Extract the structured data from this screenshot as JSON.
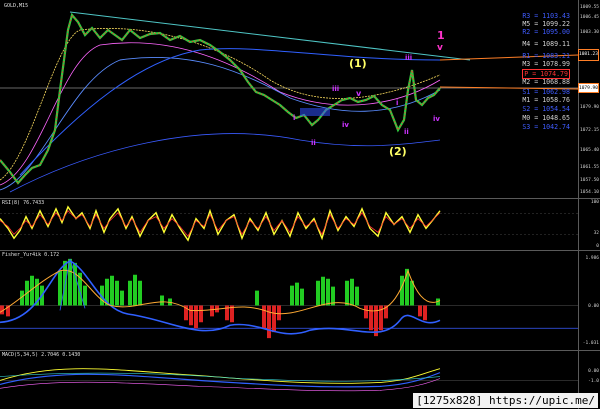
{
  "main_chart": {
    "symbol_label": "GOLD,M15",
    "price_ticks": [
      "1009.55",
      "1006.45",
      "1003.30",
      "1001.19",
      "1079.90",
      "1072.15",
      "1065.40",
      "1061.55",
      "1057.50",
      "1054.10"
    ],
    "current_price": "1079.90",
    "upper_box": "1081.23",
    "wave_labels": {
      "big_1": "1",
      "big_v": "v",
      "paren_1": "(1)",
      "paren_2": "(2)",
      "iii_top": "iii",
      "iii_left": "iii",
      "v_mid": "v",
      "iv_mid": "iv",
      "iv_right": "iv",
      "ii_left": "ii",
      "ii_right": "ii",
      "i_left": "i",
      "i_right": "i"
    },
    "pivot_levels": [
      {
        "name": "R3",
        "value": "1103.43",
        "color": "#3f5cff"
      },
      {
        "name": "M5",
        "value": "1099.22",
        "color": "#d0d0d0"
      },
      {
        "name": "R2",
        "value": "1095.00",
        "color": "#3f5cff"
      },
      {
        "name": "M4",
        "value": "1089.11",
        "color": "#d0d0d0"
      },
      {
        "name": "R1",
        "value": "1083.21",
        "color": "#3f5cff"
      },
      {
        "name": "M3",
        "value": "1078.99",
        "color": "#d0d0d0"
      },
      {
        "name": "P",
        "value": "1074.79",
        "color": "#ff3333"
      },
      {
        "name": "M2",
        "value": "1068.88",
        "color": "#d0d0d0"
      },
      {
        "name": "S1",
        "value": "1062.98",
        "color": "#3f5cff"
      },
      {
        "name": "M1",
        "value": "1058.76",
        "color": "#d0d0d0"
      },
      {
        "name": "S2",
        "value": "1054.54",
        "color": "#3f5cff"
      },
      {
        "name": "M0",
        "value": "1048.65",
        "color": "#d0d0d0"
      },
      {
        "name": "S3",
        "value": "1042.74",
        "color": "#3f5cff"
      }
    ]
  },
  "rsi_pane": {
    "label": "RSI(8) 76.7433",
    "ticks": [
      "100",
      "32",
      "0"
    ]
  },
  "fisher_pane": {
    "label": "Fisher_Yur4ik 0.172",
    "ticks": [
      "1.986",
      "0.00",
      "-1.031"
    ]
  },
  "macd_pane": {
    "label": "MACD(5,34,5) 2.7046 0.1430",
    "ticks": [
      "0.00",
      "-1.0"
    ]
  },
  "watermark": "[1275x828] https://upic.me/"
}
